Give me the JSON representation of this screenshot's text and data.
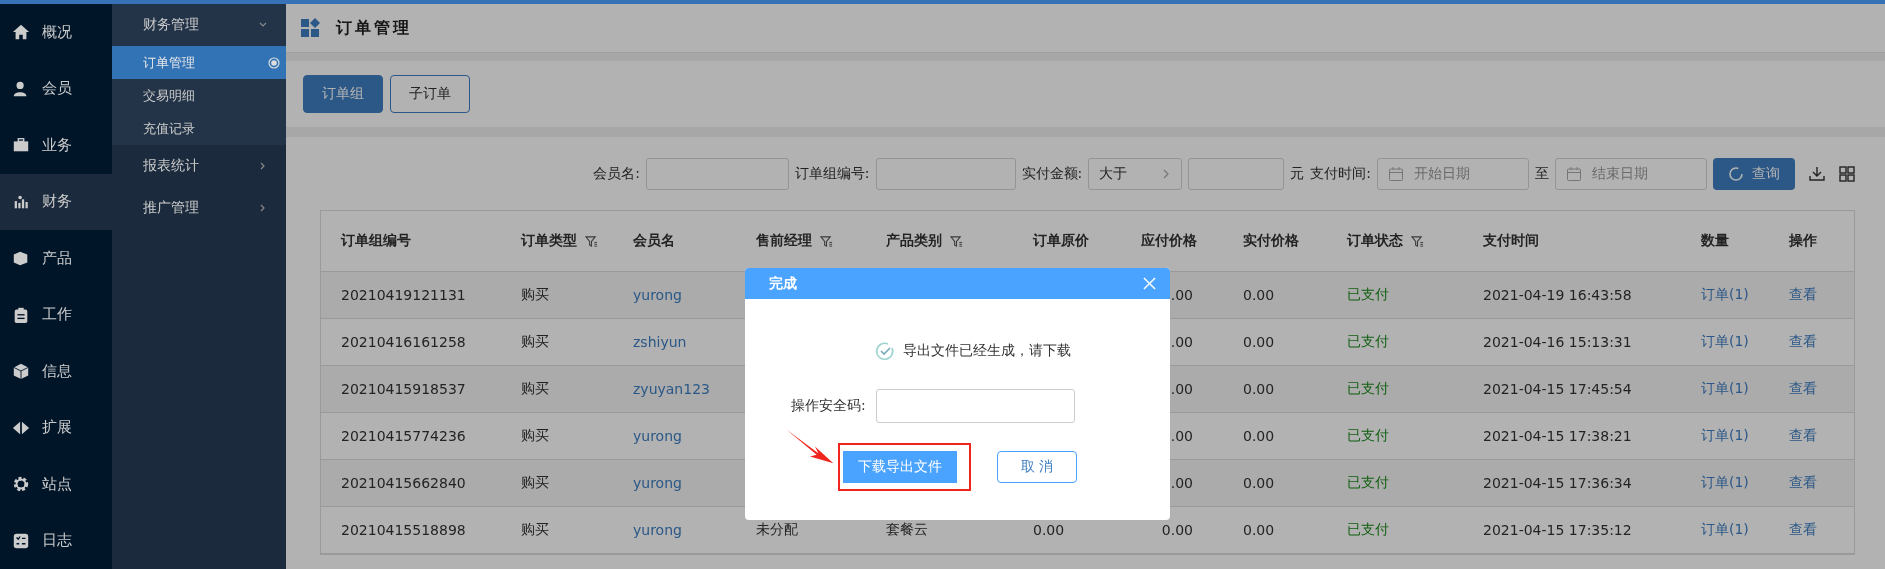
{
  "main_nav": [
    {
      "label": "概况",
      "selected": false
    },
    {
      "label": "会员",
      "selected": false
    },
    {
      "label": "业务",
      "selected": false
    },
    {
      "label": "财务",
      "selected": true
    },
    {
      "label": "产品",
      "selected": false
    },
    {
      "label": "工作",
      "selected": false
    },
    {
      "label": "信息",
      "selected": false
    },
    {
      "label": "扩展",
      "selected": false
    },
    {
      "label": "站点",
      "selected": false
    },
    {
      "label": "日志",
      "selected": false
    }
  ],
  "sub_nav": [
    {
      "label": "财务管理",
      "expanded": true,
      "children": [
        {
          "label": "订单管理",
          "selected": true
        },
        {
          "label": "交易明细",
          "selected": false
        },
        {
          "label": "充值记录",
          "selected": false
        }
      ]
    },
    {
      "label": "报表统计",
      "expanded": false
    },
    {
      "label": "推广管理",
      "expanded": false
    }
  ],
  "page_title": "订单管理",
  "tabs": [
    {
      "label": "订单组",
      "selected": true
    },
    {
      "label": "子订单",
      "selected": false
    }
  ],
  "filters": {
    "member_label": "会员名:",
    "group_no_label": "订单组编号:",
    "amount_label": "实付金额:",
    "amount_op": "大于",
    "unit": "元",
    "time_label": "支付时间:",
    "start_placeholder": "开始日期",
    "to": "至",
    "end_placeholder": "结束日期",
    "search_button": "查询"
  },
  "table": {
    "columns": [
      {
        "label": "订单组编号",
        "filter": false
      },
      {
        "label": "订单类型",
        "filter": true
      },
      {
        "label": "会员名",
        "filter": false
      },
      {
        "label": "售前经理",
        "filter": true
      },
      {
        "label": "产品类别",
        "filter": true
      },
      {
        "label": "订单原价",
        "filter": false
      },
      {
        "label": "应付价格",
        "filter": false
      },
      {
        "label": "实付价格",
        "filter": false
      },
      {
        "label": "订单状态",
        "filter": true
      },
      {
        "label": "支付时间",
        "filter": false
      },
      {
        "label": "数量",
        "filter": false
      },
      {
        "label": "操作",
        "filter": false
      }
    ],
    "rows": [
      {
        "cells": [
          "20210419121131",
          "购买",
          "yurong",
          null,
          null,
          null,
          ".00",
          "0.00",
          "已支付",
          "2021-04-19 16:43:58",
          "订单(1)",
          "查看"
        ]
      },
      {
        "cells": [
          "20210416161258",
          "购买",
          "zshiyun",
          null,
          null,
          null,
          ".00",
          "0.00",
          "已支付",
          "2021-04-16 15:13:31",
          "订单(1)",
          "查看"
        ]
      },
      {
        "cells": [
          "20210415918537",
          "购买",
          "zyuyan123",
          null,
          null,
          null,
          ".00",
          "0.00",
          "已支付",
          "2021-04-15 17:45:54",
          "订单(1)",
          "查看"
        ]
      },
      {
        "cells": [
          "20210415774236",
          "购买",
          "yurong",
          null,
          null,
          null,
          ".00",
          "0.00",
          "已支付",
          "2021-04-15 17:38:21",
          "订单(1)",
          "查看"
        ]
      },
      {
        "cells": [
          "20210415662840",
          "购买",
          "yurong",
          null,
          null,
          null,
          ".00",
          "0.00",
          "已支付",
          "2021-04-15 17:36:34",
          "订单(1)",
          "查看"
        ]
      },
      {
        "cells": [
          "20210415518898",
          "购买",
          "yurong",
          "未分配",
          "套餐云",
          "0.00",
          "0.00",
          "0.00",
          "已支付",
          "2021-04-15 17:35:12",
          "订单(1)",
          "查看"
        ]
      }
    ]
  },
  "dialog": {
    "title": "完成",
    "message": "导出文件已经生成，请下载",
    "code_label": "操作安全码:",
    "download_button": "下载导出文件",
    "cancel_button": "取 消"
  }
}
